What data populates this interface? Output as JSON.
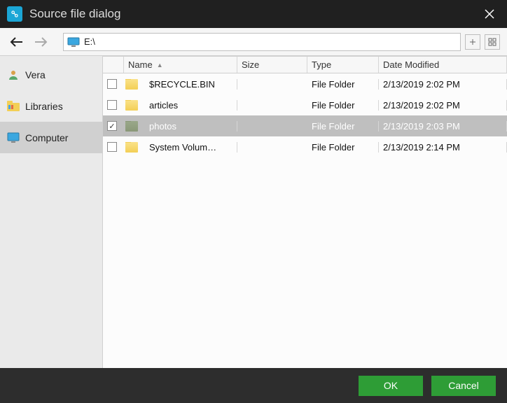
{
  "window": {
    "title": "Source file dialog"
  },
  "path": {
    "text": "E:\\"
  },
  "sidebar": {
    "items": [
      {
        "label": "Vera",
        "active": false
      },
      {
        "label": "Libraries",
        "active": false
      },
      {
        "label": "Computer",
        "active": true
      }
    ]
  },
  "columns": {
    "name": "Name",
    "size": "Size",
    "type": "Type",
    "date": "Date Modified"
  },
  "rows": [
    {
      "checked": false,
      "name": "$RECYCLE.BIN",
      "size": "",
      "type": "File Folder",
      "date": "2/13/2019 2:02 PM",
      "selected": false
    },
    {
      "checked": false,
      "name": "articles",
      "size": "",
      "type": "File Folder",
      "date": "2/13/2019 2:02 PM",
      "selected": false
    },
    {
      "checked": true,
      "name": "photos",
      "size": "",
      "type": "File Folder",
      "date": "2/13/2019 2:03 PM",
      "selected": true
    },
    {
      "checked": false,
      "name": "System Volum…",
      "size": "",
      "type": "File Folder",
      "date": "2/13/2019 2:14 PM",
      "selected": false
    }
  ],
  "buttons": {
    "ok": "OK",
    "cancel": "Cancel"
  }
}
